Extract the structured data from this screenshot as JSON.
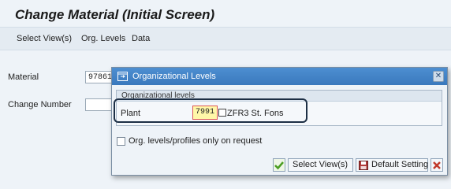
{
  "header": {
    "title": "Change Material (Initial Screen)"
  },
  "menu": {
    "items": [
      "Select View(s)",
      "Org. Levels",
      "Data"
    ]
  },
  "form": {
    "material_label": "Material",
    "material_value": "97861",
    "change_number_label": "Change Number",
    "change_number_value": ""
  },
  "dialog": {
    "title": "Organizational Levels",
    "group_title": "Organizational levels",
    "plant_label": "Plant",
    "plant_value": "7991",
    "plant_description": "ZFR3 St. Fons",
    "checkbox_label": "Org. levels/profiles only on request",
    "checkbox_checked": false,
    "buttons": {
      "select_views": "Select View(s)",
      "default_setting": "Default Setting"
    }
  },
  "colors": {
    "header_blue": "#3a79bd",
    "highlight_border": "#1d2f45",
    "input_highlight": "#fff7a8",
    "check_green": "#4a9d22",
    "cancel_red": "#c0392b"
  },
  "icons": [
    "dialog-window-icon",
    "close-icon",
    "search-help-icon",
    "checkmark-icon",
    "save-icon",
    "cancel-icon"
  ]
}
